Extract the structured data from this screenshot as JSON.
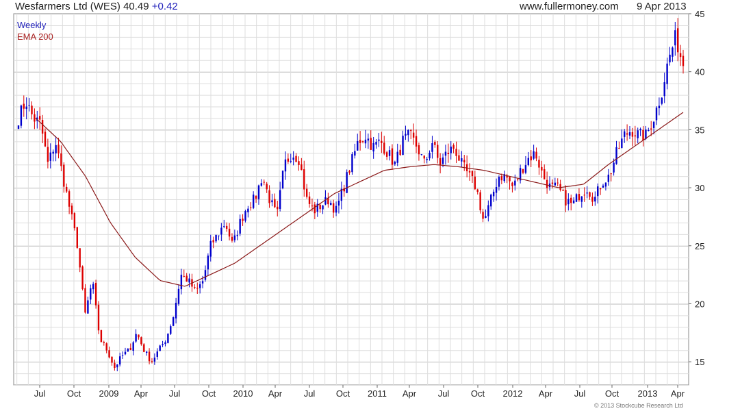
{
  "header": {
    "title": "Wesfarmers Ltd (WES) 40.49",
    "change": "+0.42",
    "website": "www.fullermoney.com",
    "date": "9 Apr 2013"
  },
  "footer": {
    "copyright": "© 2013 Stockcube Research Ltd"
  },
  "colors": {
    "up": "#0000cc",
    "down": "#dd0000",
    "ema": "#8b1a1a",
    "grid": "#dddddd"
  },
  "chart_data": {
    "type": "candlestick",
    "title": "Wesfarmers Ltd (WES) 40.49 +0.42",
    "ylim": [
      13,
      45
    ],
    "grid": true,
    "yticks": [
      15,
      20,
      25,
      30,
      35,
      40,
      45
    ],
    "x_tick_labels": [
      "Jul",
      "Oct",
      "2009",
      "Apr",
      "Jul",
      "Oct",
      "2010",
      "Apr",
      "Jul",
      "Oct",
      "2011",
      "Apr",
      "Jul",
      "Oct",
      "2012",
      "Apr",
      "Jul",
      "Oct",
      "2013",
      "Apr"
    ],
    "legend": [
      {
        "name": "Weekly",
        "color": "#2222bb"
      },
      {
        "name": "EMA 200",
        "color": "#aa2222"
      }
    ],
    "price_keypoints": [
      36,
      37.5,
      36,
      35.5,
      32,
      34,
      31,
      28,
      25,
      19,
      22,
      17,
      16,
      14.5,
      15.5,
      16,
      17.5,
      16,
      15,
      16,
      17,
      19,
      22.5,
      22,
      21,
      22,
      25,
      26,
      27,
      25,
      27,
      28.5,
      29,
      31,
      29,
      27.5,
      32,
      33,
      32.5,
      29,
      28,
      28.5,
      29,
      28,
      30,
      32,
      34,
      34.5,
      33.5,
      34,
      33,
      32,
      34,
      34.5,
      33.5,
      32,
      34,
      32,
      33,
      33.5,
      32,
      31,
      30,
      27,
      29,
      31,
      31,
      30,
      31.5,
      32.5,
      33,
      31,
      30,
      30,
      29,
      28.5,
      29.5,
      30,
      29,
      30.5,
      31,
      33,
      34.5,
      35,
      34.5,
      34.5,
      36,
      38,
      41,
      43,
      40.49
    ],
    "ema_keypoints": [
      36,
      34,
      31,
      27,
      24,
      22,
      21.5,
      22.5,
      23.5,
      25,
      26.5,
      28,
      29.5,
      30.5,
      31.5,
      31.8,
      32,
      31.8,
      31.5,
      31,
      30.5,
      30,
      30.3,
      32,
      33.5,
      35,
      36.5
    ]
  }
}
